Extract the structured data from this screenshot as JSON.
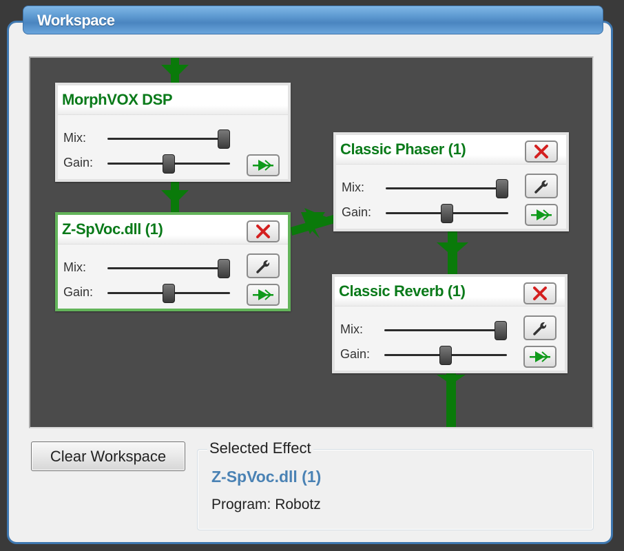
{
  "panel": {
    "title": "Workspace"
  },
  "colors": {
    "accent": "#4a85c0",
    "connector": "#0a7a0a",
    "effect_title": "#0a7a1a",
    "selected_border": "#63b45a",
    "selected_effect_text": "#4a82b4",
    "delete_icon": "#d42020"
  },
  "effects": [
    {
      "title": "MorphVOX DSP",
      "selected": false,
      "has_delete": false,
      "has_settings": false,
      "mix_label": "Mix:",
      "gain_label": "Gain:",
      "mix_value": 1.0,
      "gain_value": 0.5
    },
    {
      "title": "Z-SpVoc.dll (1)",
      "selected": true,
      "has_delete": true,
      "has_settings": true,
      "mix_label": "Mix:",
      "gain_label": "Gain:",
      "mix_value": 1.0,
      "gain_value": 0.5
    },
    {
      "title": "Classic Phaser (1)",
      "selected": false,
      "has_delete": true,
      "has_settings": true,
      "mix_label": "Mix:",
      "gain_label": "Gain:",
      "mix_value": 1.0,
      "gain_value": 0.5
    },
    {
      "title": "Classic Reverb (1)",
      "selected": false,
      "has_delete": true,
      "has_settings": true,
      "mix_label": "Mix:",
      "gain_label": "Gain:",
      "mix_value": 1.0,
      "gain_value": 0.5
    }
  ],
  "icons": {
    "delete": "close-x-icon",
    "settings": "wrench-icon",
    "bypass": "signal-flow-arrow-icon"
  },
  "footer": {
    "clear_label": "Clear Workspace",
    "group_label": "Selected Effect",
    "selected_effect": "Z-SpVoc.dll (1)",
    "program_text": "Program: Robotz"
  }
}
